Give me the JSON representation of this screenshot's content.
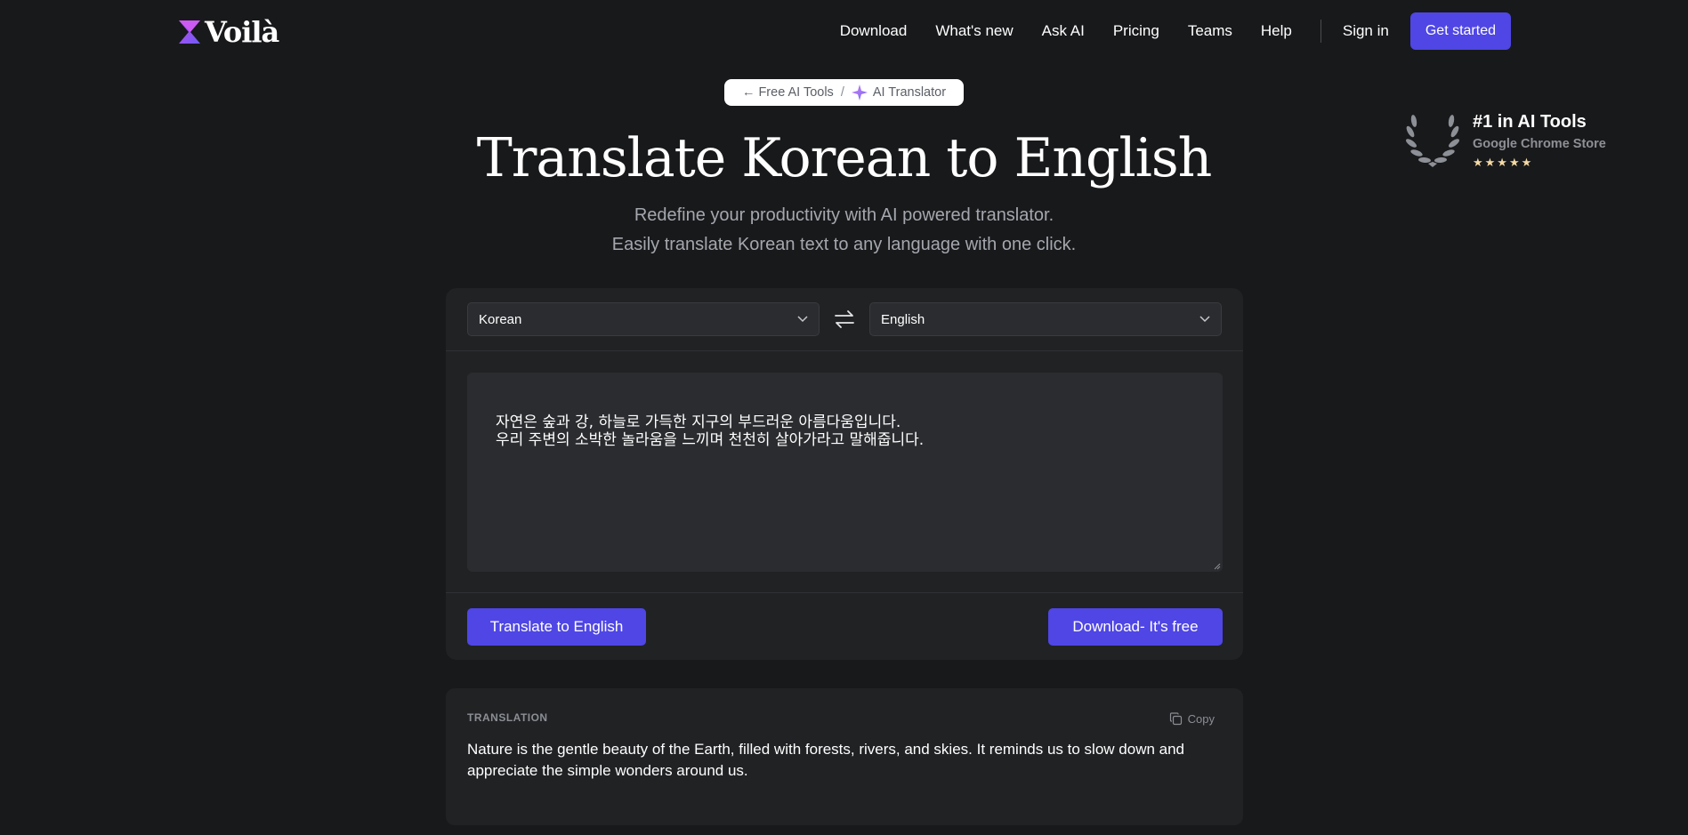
{
  "brand": {
    "name": "Voilà"
  },
  "nav": {
    "links": [
      "Download",
      "What's new",
      "Ask AI",
      "Pricing",
      "Teams",
      "Help"
    ],
    "sign_in": "Sign in",
    "get_started": "Get started"
  },
  "breadcrumb": {
    "back_arrow": "←",
    "parent": "Free AI Tools",
    "separator": "/",
    "current": "AI Translator"
  },
  "award": {
    "title": "#1 in AI Tools",
    "subtitle": "Google Chrome Store",
    "stars": "★★★★★",
    "rating": 5
  },
  "hero": {
    "title": "Translate Korean to English",
    "subtitle_line1": "Redefine your productivity with AI powered translator.",
    "subtitle_line2": "Easily translate Korean text to any language with one click."
  },
  "translator": {
    "source_language": "Korean",
    "target_language": "English",
    "input_text": "자연은 숲과 강, 하늘로 가득한 지구의 부드러운 아름다움입니다.\n우리 주변의 소박한 놀라움을 느끼며 천천히 살아가라고 말해줍니다.",
    "translate_button": "Translate to English",
    "download_button": "Download- It's free"
  },
  "result": {
    "label": "TRANSLATION",
    "copy_label": "Copy",
    "text": "Nature is the gentle beauty of the Earth, filled with forests, rivers, and skies. It reminds us to slow down and appreciate the simple wonders around us."
  },
  "colors": {
    "background": "#18191b",
    "card": "#202224",
    "accent": "#4f46e5",
    "muted_text": "#a4a7ad"
  },
  "icons": {
    "logo": "hourglass-logo-icon",
    "sparkle": "sparkle-icon",
    "swap": "swap-arrows-icon",
    "chevron": "chevron-down-icon",
    "copy": "copy-icon",
    "laurel": "laurel-wreath-icon"
  }
}
